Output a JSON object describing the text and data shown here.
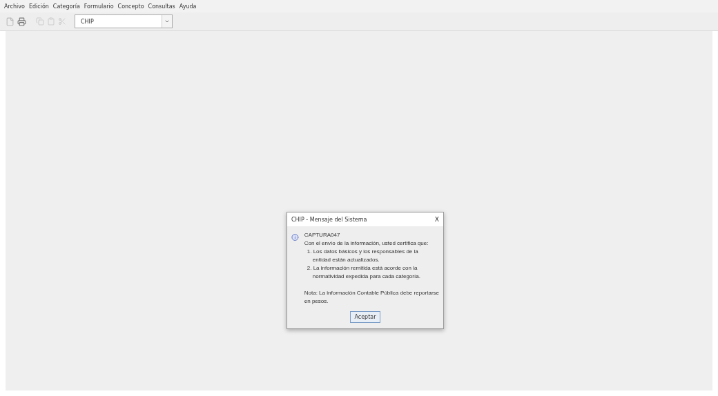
{
  "menu": [
    "Archivo",
    "Edición",
    "Categoría",
    "Formulario",
    "Concepto",
    "Consultas",
    "Ayuda"
  ],
  "toolbar": {
    "category": {
      "value": "CHIP"
    }
  },
  "dialog": {
    "title": "CHIP - Mensaje del Sistema",
    "close": "X",
    "lines": [
      {
        "kind": "plain",
        "text": "CAPTURA047"
      },
      {
        "kind": "plain",
        "text": "Con el envío de la información, usted certifica que:"
      },
      {
        "kind": "item",
        "text": "1. Los datos básicos y los responsables de la"
      },
      {
        "kind": "continuation",
        "text": "entidad están actualizados."
      },
      {
        "kind": "item",
        "text": "2. La información remitida está acorde con la"
      },
      {
        "kind": "continuation",
        "text": "normatividad expedida para cada categoría."
      },
      {
        "kind": "paragraph",
        "text": "Nota: La información Contable Pública debe reportarse"
      },
      {
        "kind": "plain",
        "text": "en pesos."
      }
    ],
    "button": "Aceptar"
  }
}
